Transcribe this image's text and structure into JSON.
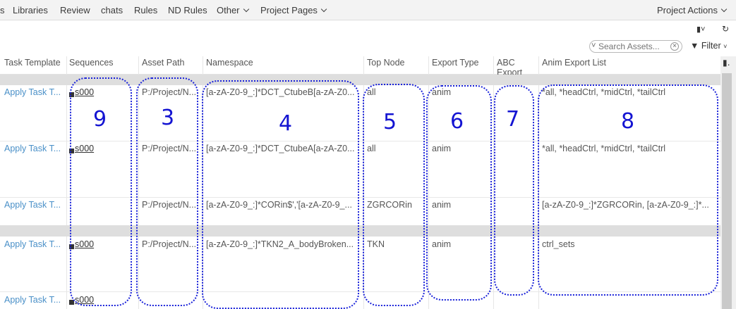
{
  "nav": {
    "items": [
      "s",
      "Libraries",
      "Review",
      "chats",
      "Rules",
      "ND Rules",
      "Other",
      "Project Pages"
    ],
    "actions": "Project Actions"
  },
  "toolbar": {
    "search_placeholder": "Search Assets...",
    "filter_label": "Filter"
  },
  "table": {
    "headers": [
      "Task Template",
      "Sequences",
      "Asset Path",
      "Namespace",
      "Top Node",
      "Export Type",
      "ABC Export",
      "Anim Export List"
    ],
    "rows": [
      {
        "task": "Apply Task T...",
        "seq": "s000",
        "path": "P:/Project/N...",
        "ns": "[a-zA-Z0-9_:]*DCT_CtubeB[a-zA-Z0...",
        "top": "all",
        "type": "anim",
        "abc": "",
        "anim": "*all, *headCtrl, *midCtrl, *tailCtrl"
      },
      {
        "task": "Apply Task T...",
        "seq": "s000",
        "path": "P:/Project/N...",
        "ns": "[a-zA-Z0-9_:]*DCT_CtubeA[a-zA-Z0...",
        "top": "all",
        "type": "anim",
        "abc": "",
        "anim": "*all, *headCtrl, *midCtrl, *tailCtrl"
      },
      {
        "task": "Apply Task T...",
        "seq": "",
        "path": "P:/Project/N...",
        "ns": "[a-zA-Z0-9_:]*CORin$','[a-zA-Z0-9_...",
        "top": "ZGRCORin",
        "type": "anim",
        "abc": "",
        "anim": "[a-zA-Z0-9_:]*ZGRCORin, [a-zA-Z0-9_:]*..."
      },
      {
        "task": "Apply Task T...",
        "seq": "s000",
        "path": "P:/Project/N...",
        "ns": "[a-zA-Z0-9_:]*TKN2_A_bodyBroken...",
        "top": "TKN",
        "type": "anim",
        "abc": "",
        "anim": "ctrl_sets"
      },
      {
        "task": "Apply Task T...",
        "seq": "s000",
        "path": "",
        "ns": "",
        "top": "",
        "type": "",
        "abc": "",
        "anim": ""
      }
    ]
  },
  "annotations": [
    "9",
    "3",
    "4",
    "5",
    "6",
    "7",
    "8"
  ],
  "colors": {
    "link": "#4a90c8",
    "annotation": "#1a22d9"
  }
}
